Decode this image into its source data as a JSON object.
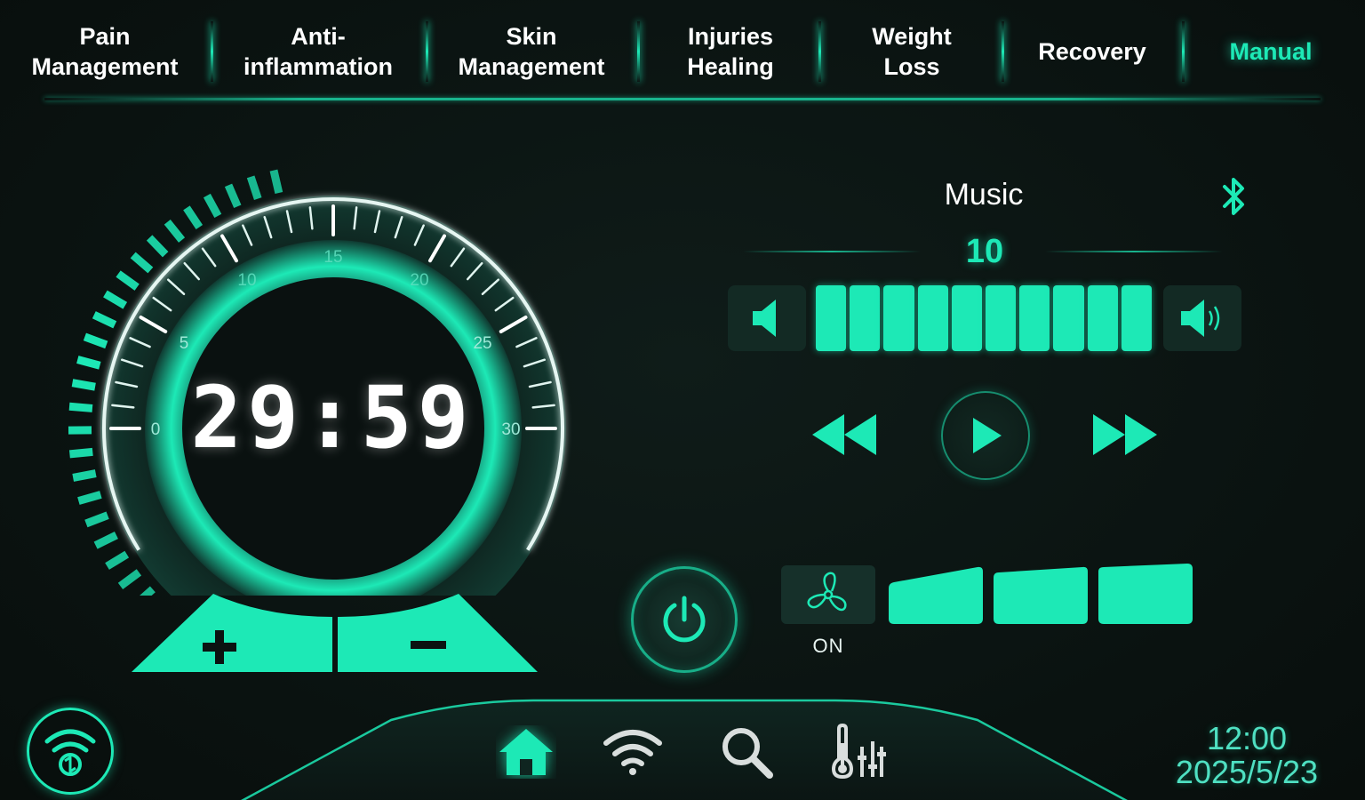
{
  "tabs": [
    {
      "label": "Pain\nManagement",
      "active": false
    },
    {
      "label": "Anti-\ninflammation",
      "active": false
    },
    {
      "label": "Skin\nManagement",
      "active": false
    },
    {
      "label": "Injuries\nHealing",
      "active": false
    },
    {
      "label": "Weight\nLoss",
      "active": false
    },
    {
      "label": "Recovery",
      "active": false
    },
    {
      "label": "Manual",
      "active": true
    }
  ],
  "timer": {
    "display": "29:59",
    "dial_labels": [
      "0",
      "5",
      "10",
      "15",
      "20",
      "25",
      "30"
    ],
    "dial_max_minutes": 30,
    "remaining_fraction": 0.9994,
    "plus_icon": "plus-icon",
    "minus_icon": "minus-icon"
  },
  "music": {
    "title": "Music",
    "volume": "10",
    "volume_level": 10,
    "volume_max": 10,
    "bluetooth_icon": "bluetooth-icon",
    "volume_down_icon": "volume-down-icon",
    "volume_up_icon": "volume-up-icon",
    "rewind_icon": "rewind-icon",
    "play_icon": "play-icon",
    "forward_icon": "fast-forward-icon"
  },
  "fan": {
    "label": "ON",
    "icon": "fan-icon",
    "level": 3,
    "level_max": 3
  },
  "power": {
    "icon": "power-icon"
  },
  "bottom_nav": {
    "items": [
      "home-icon",
      "wifi-icon",
      "search-icon",
      "temperature-settings-icon"
    ],
    "active": "home-icon"
  },
  "status": {
    "icon": "wifi-sync-icon"
  },
  "clock": {
    "time": "12:00",
    "date": "2025/5/23"
  },
  "colors": {
    "accent": "#1de9b6",
    "background": "#0b1311",
    "panel": "#132a24"
  }
}
